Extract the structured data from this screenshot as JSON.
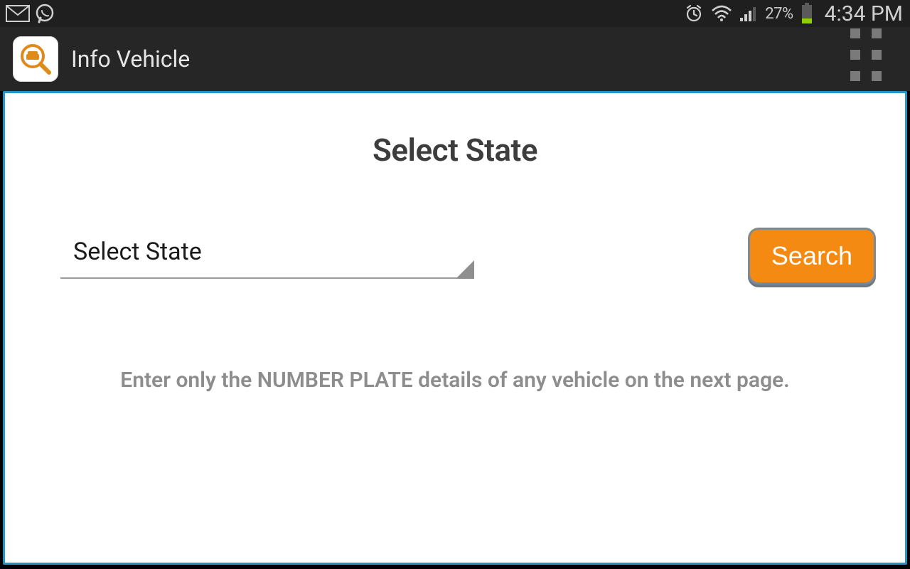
{
  "status": {
    "battery_pct": "27%",
    "time": "4:34 PM"
  },
  "actionbar": {
    "title": "Info Vehicle"
  },
  "main": {
    "heading": "Select State",
    "spinner_value": "Select State",
    "search_label": "Search",
    "hint": "Enter only the NUMBER PLATE details of any vehicle on the next page."
  }
}
